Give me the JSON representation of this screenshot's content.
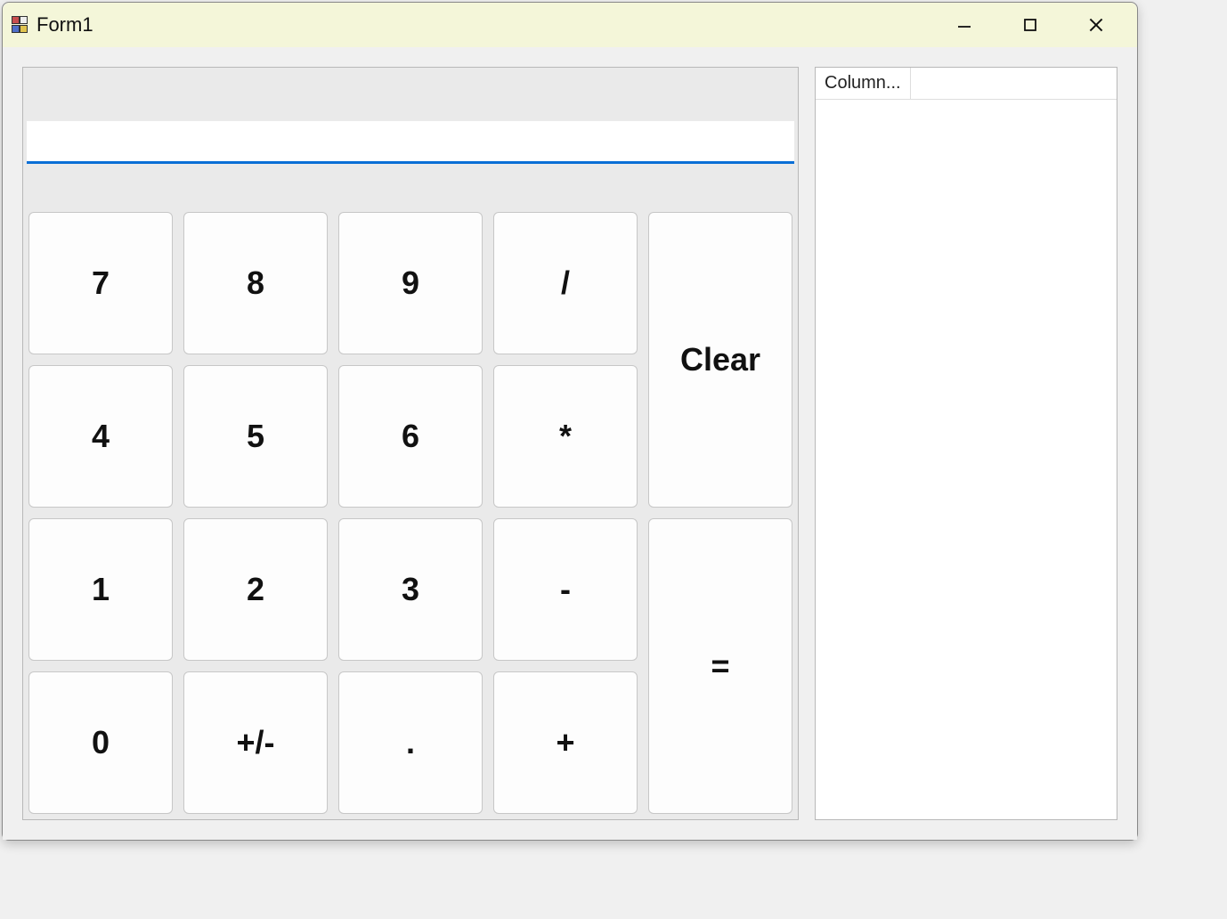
{
  "window": {
    "title": "Form1"
  },
  "display": {
    "value": ""
  },
  "keys": {
    "k7": "7",
    "k8": "8",
    "k9": "9",
    "div": "/",
    "clear": "Clear",
    "k4": "4",
    "k5": "5",
    "k6": "6",
    "mul": "*",
    "k1": "1",
    "k2": "2",
    "k3": "3",
    "sub": "-",
    "eq": "=",
    "k0": "0",
    "sign": "+/-",
    "dot": ".",
    "add": "+"
  },
  "list": {
    "columns": [
      "ColumnHeader"
    ]
  }
}
